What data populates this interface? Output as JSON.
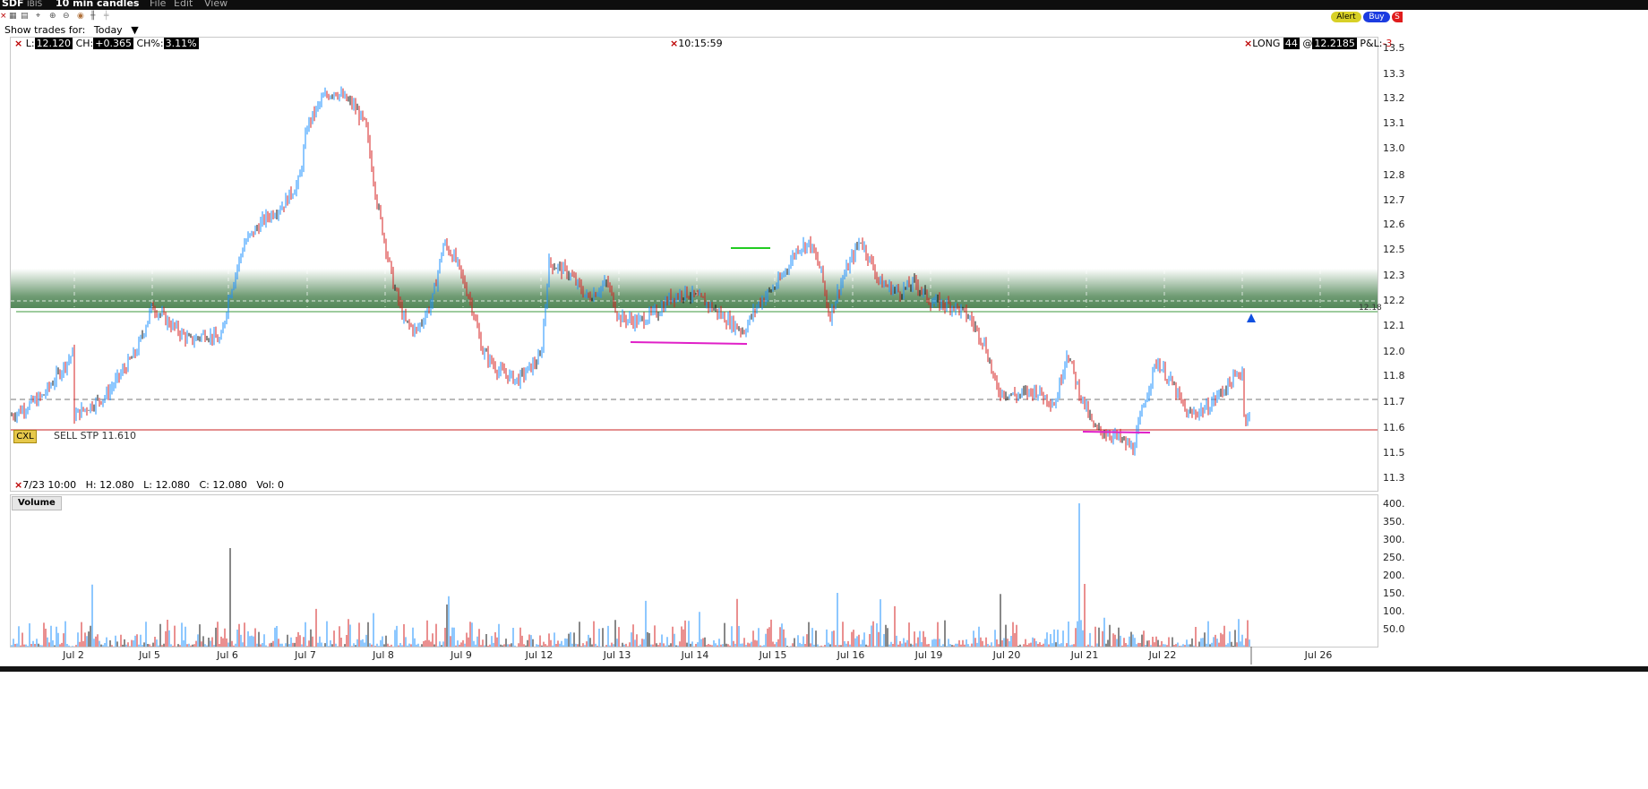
{
  "titlebar": {
    "symbol": "SDF",
    "exchange": "IBIS",
    "interval": "10 min candles",
    "menu": [
      "File",
      "Edit",
      "View"
    ]
  },
  "trade_buttons": {
    "alert": "Alert",
    "buy": "Buy",
    "sell": "S"
  },
  "show_trades": {
    "label": "Show trades for:",
    "value": "Today"
  },
  "header": {
    "last_label": "L:",
    "last": "12.120",
    "change_label": "CH:",
    "change": "+0.365",
    "change_pct_label": "CH%:",
    "change_pct": "3.11%",
    "time": "10:15:59",
    "position_label": "LONG",
    "position_qty": "44",
    "at": "@",
    "avg_price": "12.2185",
    "pnl_label": "P&L:",
    "pnl": "-3"
  },
  "order": {
    "cancel": "CXL",
    "text": "SELL STP 11.610"
  },
  "ohlc": {
    "date": "7/23 10:00",
    "h_label": "H:",
    "h": "12.080",
    "l_label": "L:",
    "l": "12.080",
    "c_label": "C:",
    "c": "12.080",
    "vol_label": "Vol:",
    "vol": "0"
  },
  "volume_panel": {
    "label": "Volume"
  },
  "price_line_tag": "12.18",
  "y_axis": [
    "13.5",
    "13.3",
    "13.2",
    "13.1",
    "13.0",
    "12.8",
    "12.7",
    "12.6",
    "12.5",
    "12.3",
    "12.2",
    "12.1",
    "12.0",
    "11.8",
    "11.7",
    "11.6",
    "11.5",
    "11.3"
  ],
  "vol_axis": [
    "400.",
    "350.",
    "300.",
    "250.",
    "200.",
    "150.",
    "100.",
    "50.0"
  ],
  "x_axis": [
    "Jul 2",
    "Jul 5",
    "Jul 6",
    "Jul 7",
    "Jul 8",
    "Jul 9",
    "Jul 12",
    "Jul 13",
    "Jul 14",
    "Jul 15",
    "Jul 16",
    "Jul 19",
    "Jul 20",
    "Jul 21",
    "Jul 22",
    "Jul 26"
  ],
  "colors": {
    "up": "#1e90ff",
    "down": "#d42020",
    "flat": "#111111",
    "zone": "#3f7a45",
    "support": "#3c9a3c",
    "stop": "#c82020",
    "magenta": "#e020c8",
    "green_mark": "#22cc22"
  },
  "chart_data": {
    "type": "candlestick",
    "interval": "10 min",
    "x": [
      "Jul 2",
      "Jul 5",
      "Jul 6",
      "Jul 7",
      "Jul 8",
      "Jul 9",
      "Jul 12",
      "Jul 13",
      "Jul 14",
      "Jul 15",
      "Jul 16",
      "Jul 19",
      "Jul 20",
      "Jul 21",
      "Jul 22",
      "Jul 23"
    ],
    "close_path": [
      [
        0,
        11.62
      ],
      [
        0.4,
        11.72
      ],
      [
        0.8,
        11.95
      ],
      [
        1.0,
        12.18
      ],
      [
        1.2,
        12.1
      ],
      [
        1.5,
        12.0
      ],
      [
        1.7,
        12.04
      ],
      [
        1.9,
        12.0
      ],
      [
        2.0,
        12.22
      ],
      [
        2.2,
        12.5
      ],
      [
        2.45,
        12.62
      ],
      [
        2.7,
        12.7
      ],
      [
        2.9,
        12.82
      ],
      [
        3.0,
        13.1
      ],
      [
        3.2,
        13.24
      ],
      [
        3.35,
        13.28
      ],
      [
        3.6,
        13.2
      ],
      [
        3.75,
        13.1
      ],
      [
        3.9,
        12.7
      ],
      [
        4.1,
        12.3
      ],
      [
        4.25,
        12.1
      ],
      [
        4.4,
        12.05
      ],
      [
        4.6,
        12.2
      ],
      [
        4.75,
        12.5
      ],
      [
        4.9,
        12.42
      ],
      [
        5.1,
        12.2
      ],
      [
        5.25,
        11.95
      ],
      [
        5.45,
        11.85
      ],
      [
        5.7,
        11.8
      ],
      [
        6.0,
        11.92
      ],
      [
        6.1,
        12.4
      ],
      [
        6.35,
        12.35
      ],
      [
        6.6,
        12.22
      ],
      [
        6.85,
        12.3
      ],
      [
        7.0,
        12.12
      ],
      [
        7.25,
        12.1
      ],
      [
        7.5,
        12.15
      ],
      [
        7.65,
        12.22
      ],
      [
        7.85,
        12.25
      ],
      [
        8.1,
        12.2
      ],
      [
        8.35,
        12.12
      ],
      [
        8.6,
        12.05
      ],
      [
        8.8,
        12.2
      ],
      [
        9.05,
        12.3
      ],
      [
        9.3,
        12.48
      ],
      [
        9.45,
        12.5
      ],
      [
        9.6,
        12.35
      ],
      [
        9.7,
        12.12
      ],
      [
        9.85,
        12.3
      ],
      [
        10.1,
        12.52
      ],
      [
        10.35,
        12.3
      ],
      [
        10.6,
        12.25
      ],
      [
        10.8,
        12.3
      ],
      [
        11.0,
        12.2
      ],
      [
        11.3,
        12.18
      ],
      [
        11.5,
        12.12
      ],
      [
        11.7,
        11.98
      ],
      [
        11.85,
        11.75
      ],
      [
        12.1,
        11.72
      ],
      [
        12.35,
        11.75
      ],
      [
        12.6,
        11.68
      ],
      [
        12.75,
        11.95
      ],
      [
        12.9,
        11.75
      ],
      [
        13.1,
        11.55
      ],
      [
        13.35,
        11.52
      ],
      [
        13.6,
        11.45
      ],
      [
        13.75,
        11.7
      ],
      [
        13.9,
        11.9
      ],
      [
        14.1,
        11.78
      ],
      [
        14.3,
        11.62
      ],
      [
        14.55,
        11.66
      ],
      [
        14.75,
        11.75
      ],
      [
        15.0,
        11.85
      ],
      [
        15.1,
        11.72
      ],
      [
        15.35,
        11.98
      ],
      [
        15.6,
        11.95
      ],
      [
        15.85,
        11.85
      ],
      [
        15.95,
        11.75
      ],
      [
        16.05,
        11.98
      ],
      [
        16.15,
        12.08
      ]
    ],
    "y_range": [
      11.3,
      13.5
    ],
    "resistance_zone": [
      12.18,
      12.32
    ],
    "support_line": 12.18,
    "stop_line": 11.61,
    "avg_cost_line": 11.71,
    "volume": {
      "range": [
        0,
        400
      ],
      "spike": {
        "x": "Jul 21",
        "value": 400
      }
    }
  }
}
